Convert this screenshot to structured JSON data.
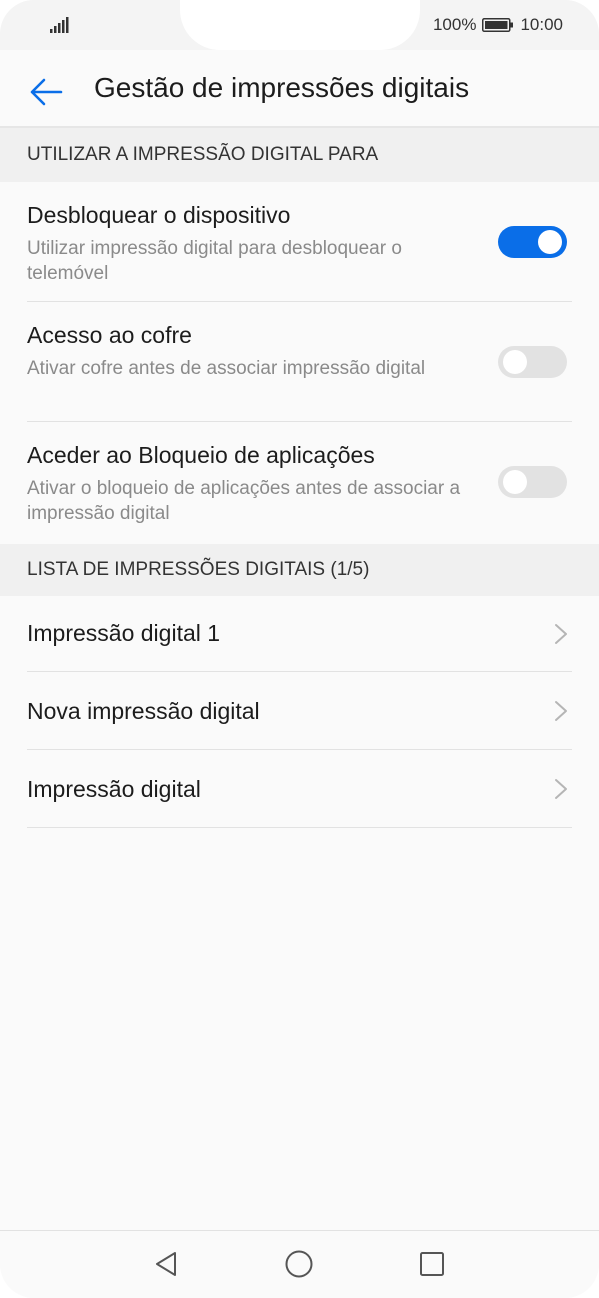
{
  "status": {
    "battery_percent": "100%",
    "time": "10:00",
    "icons": [
      "signal-icon",
      "battery-icon"
    ]
  },
  "header": {
    "title": "Gestão de impressões digitais",
    "back_icon": "arrow-left-icon"
  },
  "section_use": {
    "heading": "UTILIZAR A IMPRESSÃO DIGITAL PARA",
    "items": [
      {
        "title": "Desbloquear o dispositivo",
        "subtitle": "Utilizar impressão digital para desbloquear o telemóvel",
        "toggle": "on"
      },
      {
        "title": "Acesso ao cofre",
        "subtitle": "Ativar cofre antes de associar impressão digital",
        "toggle": "off"
      },
      {
        "title": "Aceder ao Bloqueio de aplicações",
        "subtitle": "Ativar o bloqueio de aplicações antes de associar a impressão digital",
        "toggle": "off"
      }
    ]
  },
  "section_list": {
    "heading": "LISTA DE IMPRESSÕES DIGITAIS (1/5)",
    "items": [
      {
        "title": "Impressão digital 1"
      },
      {
        "title": "Nova impressão digital"
      },
      {
        "title": "Impressão digital"
      }
    ]
  },
  "nav": {
    "icons": [
      "back-triangle-icon",
      "home-circle-icon",
      "recents-square-icon"
    ]
  },
  "colors": {
    "accent": "#0a6ee8",
    "toggle_off": "#e2e2e2",
    "background": "#fafafa",
    "section_bg": "#f0f0f0"
  }
}
